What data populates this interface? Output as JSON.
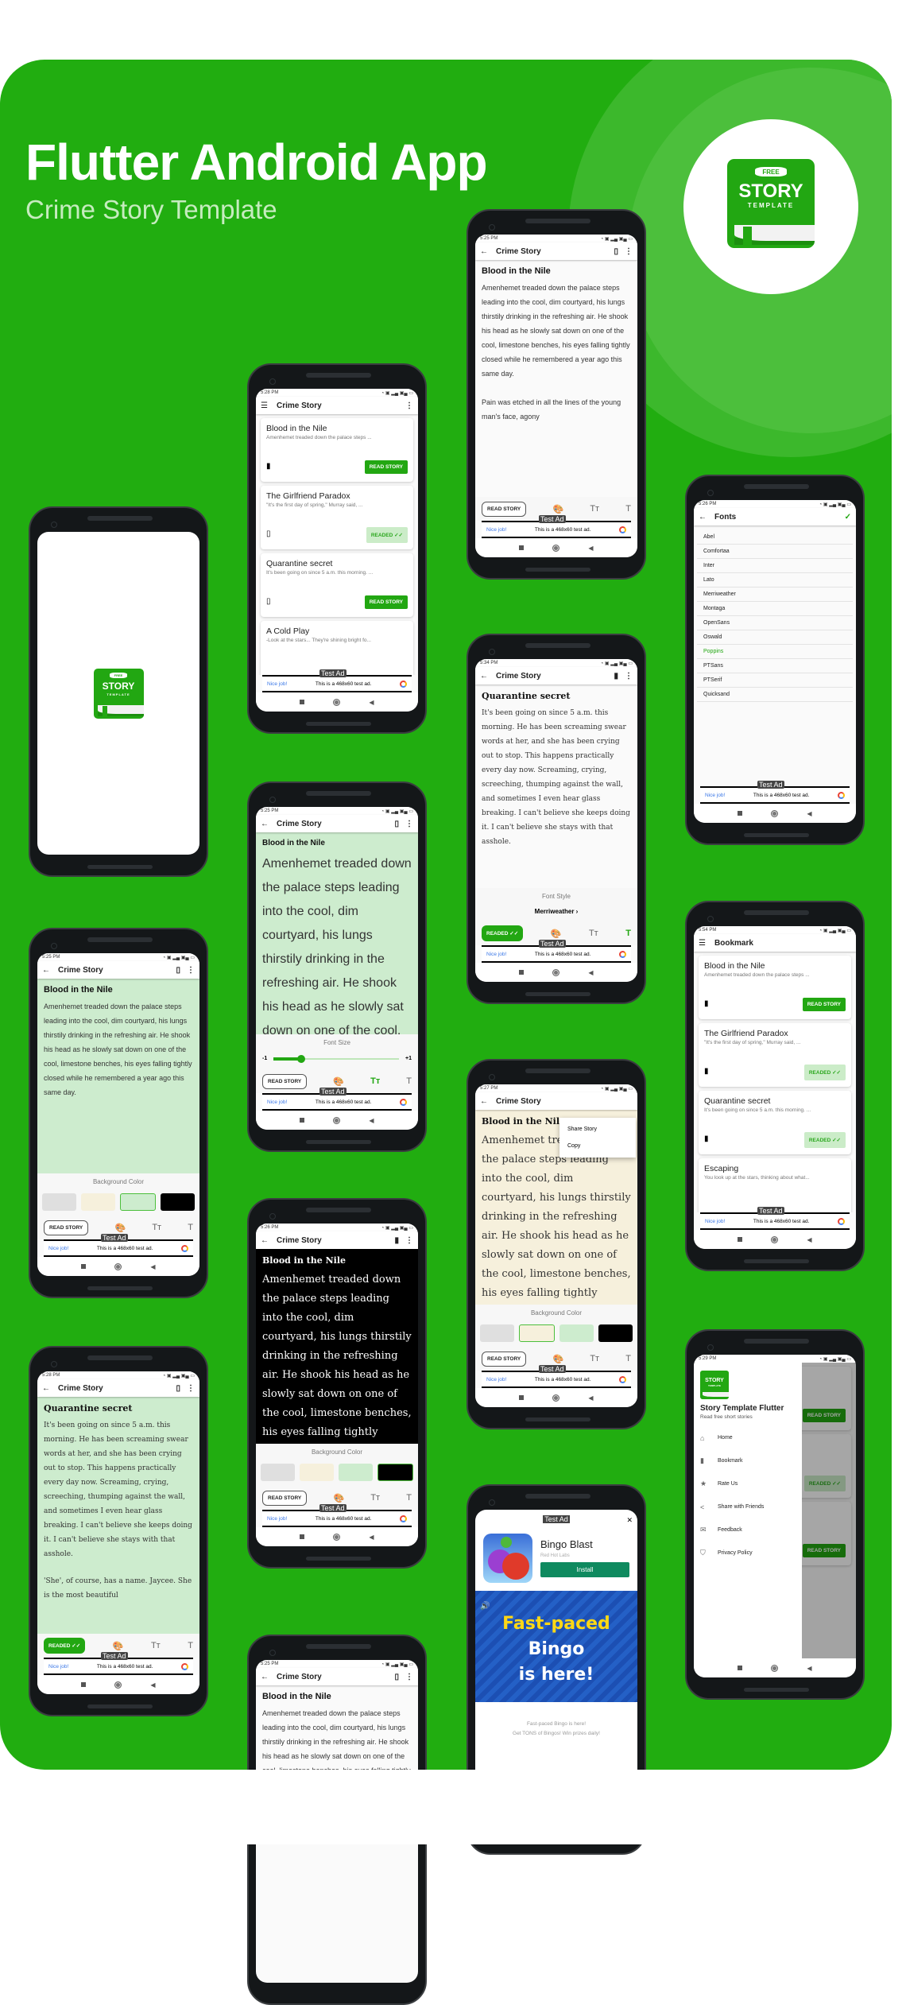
{
  "hero": {
    "title": "Flutter Android App",
    "subtitle": "Crime Story Template"
  },
  "logo": {
    "free": "FREE",
    "story": "STORY",
    "template": "TEMPLATE"
  },
  "colors": {
    "brand": "#22a712",
    "readed_bg": "#cbecc8",
    "bg_gray": "#dfdfdf",
    "bg_cream": "#f6f0dc",
    "bg_green": "#cdecce",
    "bg_black": "#000000"
  },
  "common": {
    "app_title": "Crime Story",
    "ad_nice": "Nice job!",
    "ad_text": "This is a 468x60 test ad.",
    "ad_label": "Test Ad",
    "read_story": "READ STORY",
    "readed": "READED",
    "check": "✓✓",
    "bg_color_label": "Background Color",
    "font_size_label": "Font Size",
    "font_style_label": "Font Style"
  },
  "stories": [
    {
      "title": "Blood in the Nile",
      "snippet": "Amenhemet treaded down the palace steps ...",
      "text": "Amenhemet treaded down the palace steps leading into the cool, dim courtyard, his lungs thirstily drinking in the refreshing air. He shook his head as he slowly sat down on one of the cool, limestone benches, his eyes falling tightly closed while he remembered a year ago this same day.",
      "text2": "Pain was etched in all the lines of the young man's face, agony"
    },
    {
      "title": "The Girlfriend Paradox",
      "snippet": "\"It's the first day of spring,\" Murray said, ..."
    },
    {
      "title": "Quarantine secret",
      "snippet": "It's been going on since 5 a.m. this morning. ...",
      "text": "It's been going on since 5 a.m. this morning. He has been screaming swear words at her, and she has been crying out to stop. This happens practically every day now. Screaming, crying, screeching, thumping against the wall, and sometimes I even hear glass breaking. I can't believe she keeps doing it. I can't believe she stays with that asshole.",
      "text2": "'She', of course, has a name. Jaycee. She is the most beautiful"
    },
    {
      "title": "A Cold Play",
      "snippet": "-Look at the stars... They're shining bright fo..."
    },
    {
      "title": "Escaping",
      "snippet": "You look up at the stars, thinking about what..."
    }
  ],
  "phones": {
    "home": {
      "time": "5:28 PM"
    },
    "reader1": {
      "time": "5:25 PM"
    },
    "fonts": {
      "time": "5:26 PM",
      "title": "Fonts",
      "items": [
        "Abel",
        "Comfortaa",
        "Inter",
        "Lato",
        "Merriweather",
        "Montaga",
        "OpenSans",
        "Oswald",
        "Poppins",
        "PTSans",
        "PTSerif",
        "Quicksand"
      ],
      "selected": "Poppins"
    },
    "fontstyle": {
      "time": "5:34 PM",
      "current_font": "Merriweather"
    },
    "fontsize": {
      "time": "5:25 PM",
      "min_label": "-1",
      "max_label": "+1",
      "value_fraction": 0.22
    },
    "bookmark": {
      "time": "5:54 PM",
      "title": "Bookmark"
    },
    "bggreen": {
      "time": "5:25 PM"
    },
    "menu": {
      "time": "5:27 PM",
      "items": [
        "Share Story",
        "Copy"
      ]
    },
    "dark": {
      "time": "5:26 PM"
    },
    "drawer": {
      "time": "5:29 PM",
      "title": "Story Template Flutter",
      "subtitle": "Read free short stories",
      "items": [
        "Home",
        "Bookmark",
        "Rate Us",
        "Share with Friends",
        "Feedback",
        "Privacy Policy"
      ]
    },
    "quarantine": {
      "time": "5:28 PM"
    },
    "interstitial": {
      "ad_label": "Test Ad",
      "app_name": "Bingo Blast",
      "developer": "Red Hot Labs",
      "install": "Install",
      "banner_line1": "Fast-paced",
      "banner_line1b": "Bingo",
      "banner_line2": "is here!",
      "desc1": "Fast-paced Bingo is here!",
      "desc2": "Get TONS of Bingos! Win prizes daily!"
    },
    "bottom": {
      "time": "5:25 PM"
    }
  }
}
